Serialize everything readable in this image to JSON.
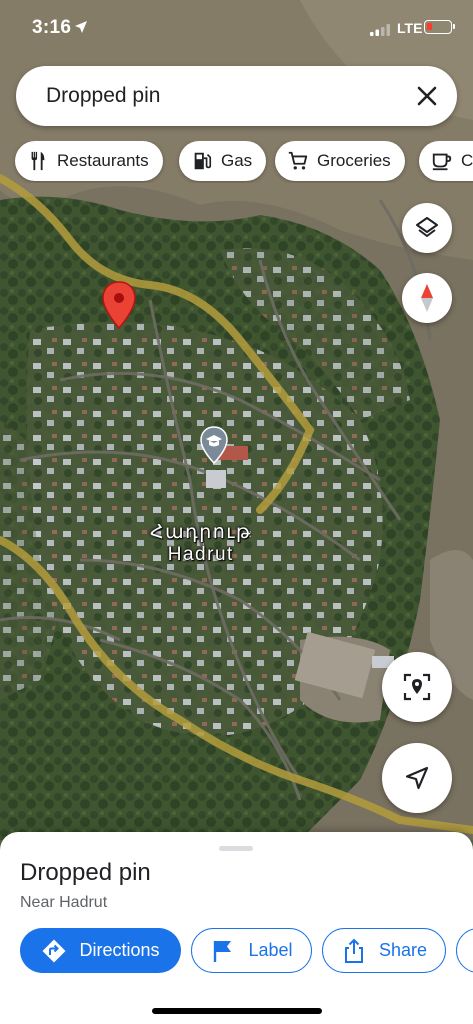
{
  "status_bar": {
    "time": "3:16",
    "network": "LTE"
  },
  "search": {
    "value": "Dropped pin"
  },
  "chips": [
    {
      "label": "Restaurants",
      "icon": "fork-knife-icon"
    },
    {
      "label": "Gas",
      "icon": "gas-station-icon"
    },
    {
      "label": "Groceries",
      "icon": "cart-icon"
    },
    {
      "label": "Coffee",
      "icon": "coffee-cup-icon"
    }
  ],
  "map": {
    "town_label_native": "Հադրութ",
    "town_label_latin": "Hadrut"
  },
  "place": {
    "title": "Dropped pin",
    "subtitle": "Near Hadrut"
  },
  "actions": {
    "directions": "Directions",
    "label": "Label",
    "share": "Share"
  },
  "colors": {
    "accent": "#1a73e8",
    "pin": "#ea4335",
    "battery_low": "#ff3b30"
  }
}
